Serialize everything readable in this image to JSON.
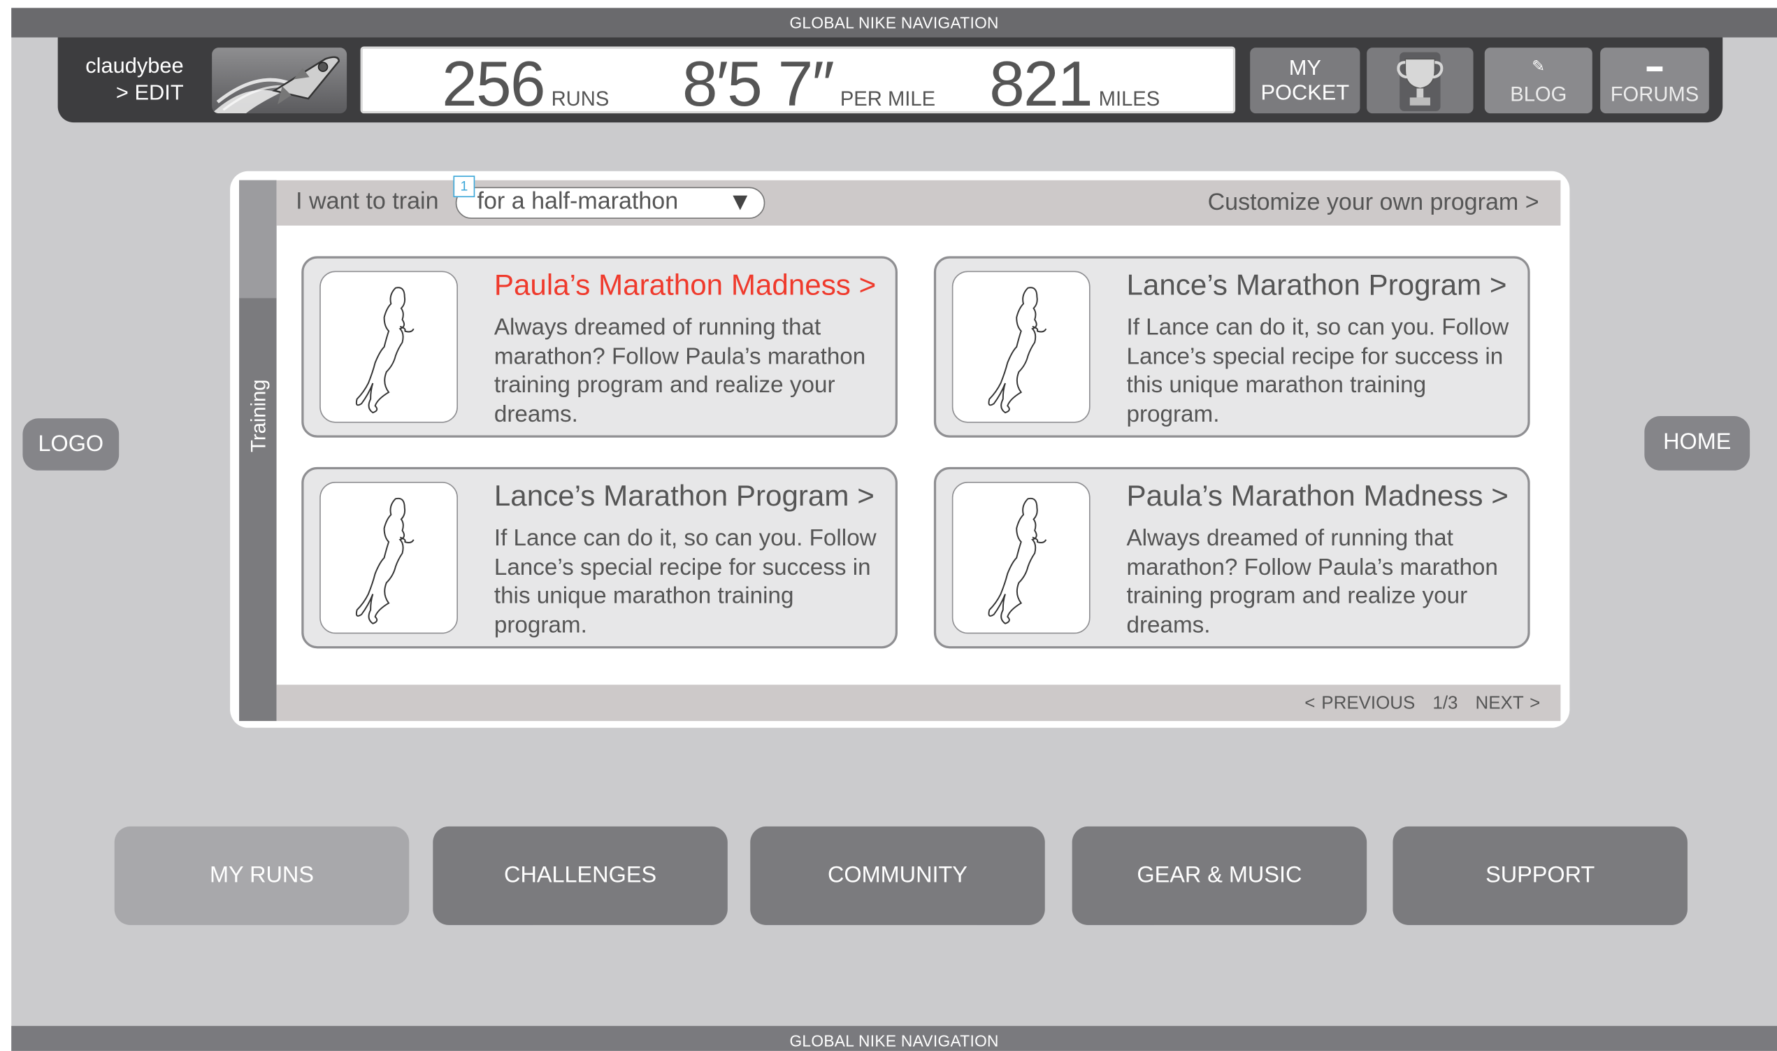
{
  "global_nav": {
    "top_label": "GLOBAL NIKE NAVIGATION",
    "bottom_label": "GLOBAL NIKE NAVIGATION"
  },
  "user": {
    "name": "claudybee",
    "edit_label": "> EDIT"
  },
  "stats": {
    "runs": {
      "value": "256",
      "unit": "RUNS"
    },
    "pace": {
      "value": "8′5 7″",
      "unit": "PER MILE"
    },
    "miles": {
      "value": "821",
      "unit": "MILES"
    }
  },
  "header_buttons": {
    "pocket": "MY\nPOCKET",
    "blog": "BLOG",
    "forums": "FORUMS"
  },
  "side": {
    "logo": "LOGO",
    "home": "HOME"
  },
  "training": {
    "tab_label": "Training",
    "filter_label": "I want to train",
    "select_value": "for a half-marathon",
    "marker": "1",
    "customize_link": "Customize your own program >",
    "cards": [
      {
        "title": "Paula’s Marathon Madness >",
        "desc": "Always dreamed of running that marathon? Follow Paula’s marathon training program and realize your dreams."
      },
      {
        "title": "Lance’s Marathon Program >",
        "desc": "If Lance can do it, so can you. Follow Lance’s special recipe for success in this unique marathon training program."
      },
      {
        "title": "Lance’s Marathon Program >",
        "desc": "If Lance can do it, so can you. Follow Lance’s special recipe for success in this unique marathon training program."
      },
      {
        "title": "Paula’s Marathon Madness >",
        "desc": "Always dreamed of running that marathon? Follow Paula’s marathon training program and realize your dreams."
      }
    ],
    "pager": {
      "prev": "< PREVIOUS",
      "page": "1/3",
      "next": "NEXT >"
    }
  },
  "nav": [
    "MY RUNS",
    "CHALLENGES",
    "COMMUNITY",
    "GEAR & MUSIC",
    "SUPPORT"
  ],
  "colors": {
    "accent_red": "#ef3a2c",
    "marker_blue": "#3aa6d8",
    "background": "#cbcbcd"
  }
}
